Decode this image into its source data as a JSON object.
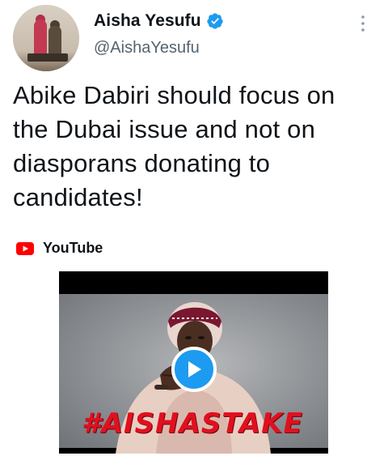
{
  "author": {
    "display_name": "Aisha Yesufu",
    "handle": "@AishaYesufu",
    "verified": true,
    "avatar_icon": "profile-photo"
  },
  "tweet": {
    "text_lines": [
      "Abike Dabiri should focus on",
      "the Dubai issue and not on",
      "diasporans donating to",
      "candidates!"
    ]
  },
  "card": {
    "source_label": "YouTube",
    "source_icon": "youtube-icon",
    "thumbnail_overlay_text": "#AISHASTAKE",
    "play_icon": "play-icon"
  },
  "colors": {
    "accent": "#1d9bf0",
    "secondary_text": "#536471",
    "youtube_red": "#ff0000",
    "hashtag_red": "#e0101f"
  }
}
